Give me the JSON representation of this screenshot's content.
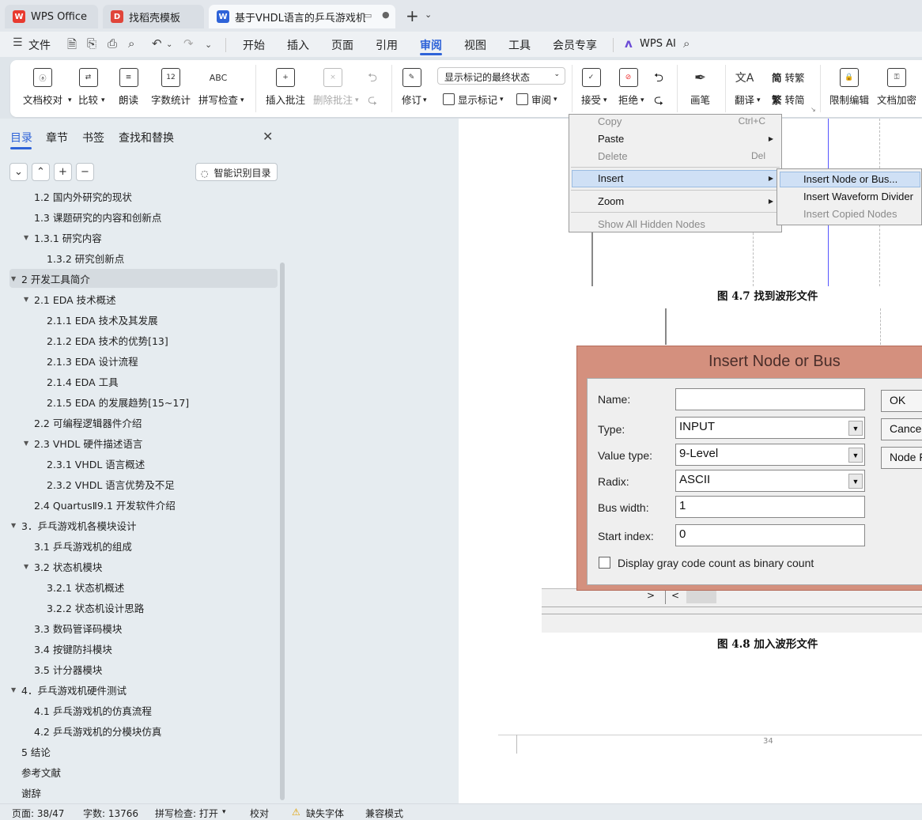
{
  "tabs": [
    {
      "label": "WPS Office",
      "icon": "wps-logo-icon"
    },
    {
      "label": "找稻壳模板",
      "icon": "docer-icon"
    },
    {
      "label": "基于VHDL语言的乒乓游戏机电",
      "icon": "word-doc-icon"
    }
  ],
  "menu": {
    "file": "文件",
    "items": [
      "开始",
      "插入",
      "页面",
      "引用",
      "审阅",
      "视图",
      "工具",
      "会员专享"
    ],
    "active": "审阅",
    "wps_ai": "WPS AI"
  },
  "ribbon": {
    "doc_check": "文档校对",
    "compare": "比较",
    "read_aloud": "朗读",
    "word_count": "字数统计",
    "spell_check": "拼写检查",
    "insert_comment": "插入批注",
    "delete_comment": "删除批注",
    "revise": "修订",
    "markup_select": "显示标记的最终状态",
    "show_markup": "显示标记",
    "review": "审阅",
    "accept": "接受",
    "reject": "拒绝",
    "pen": "画笔",
    "translate": "翻译",
    "to_traditional": "转繁",
    "to_simplified": "转简",
    "restrict_edit": "限制编辑",
    "encrypt": "文档加密"
  },
  "nav": {
    "tabs": [
      "目录",
      "章节",
      "书签",
      "查找和替换"
    ],
    "active_tab": "目录",
    "smart_toc": "智能识别目录"
  },
  "toc": [
    {
      "text": "1.2 国内外研究的现状",
      "level": 2,
      "expand": ""
    },
    {
      "text": "1.3 课题研究的内容和创新点",
      "level": 2,
      "expand": ""
    },
    {
      "text": "1.3.1  研究内容",
      "level": 2,
      "expand": "▼"
    },
    {
      "text": "1.3.2  研究创新点",
      "level": 3,
      "expand": ""
    },
    {
      "text": "2  开发工具简介",
      "level": 1,
      "expand": "▼",
      "selected": true
    },
    {
      "text": "2.1 EDA 技术概述",
      "level": 2,
      "expand": "▼"
    },
    {
      "text": "2.1.1 EDA 技术及其发展",
      "level": 3,
      "expand": ""
    },
    {
      "text": "2.1.2 EDA 技术的优势[13]",
      "level": 3,
      "expand": ""
    },
    {
      "text": "2.1.3 EDA 设计流程",
      "level": 3,
      "expand": ""
    },
    {
      "text": "2.1.4 EDA 工具",
      "level": 3,
      "expand": ""
    },
    {
      "text": "2.1.5 EDA 的发展趋势[15~17]",
      "level": 3,
      "expand": ""
    },
    {
      "text": "2.2 可编程逻辑器件介绍",
      "level": 2,
      "expand": ""
    },
    {
      "text": "2.3 VHDL 硬件描述语言",
      "level": 2,
      "expand": "▼"
    },
    {
      "text": "2.3.1 VHDL 语言概述",
      "level": 3,
      "expand": ""
    },
    {
      "text": "2.3.2 VHDL 语言优势及不足",
      "level": 3,
      "expand": ""
    },
    {
      "text": "2.4 QuartusⅡ9.1 开发软件介绍",
      "level": 2,
      "expand": ""
    },
    {
      "text": "3．乒乓游戏机各模块设计",
      "level": 1,
      "expand": "▼"
    },
    {
      "text": "3.1 乒乓游戏机的组成",
      "level": 2,
      "expand": ""
    },
    {
      "text": "3.2 状态机模块",
      "level": 2,
      "expand": "▼"
    },
    {
      "text": "3.2.1  状态机概述",
      "level": 3,
      "expand": ""
    },
    {
      "text": "3.2.2  状态机设计思路",
      "level": 3,
      "expand": ""
    },
    {
      "text": "3.3 数码管译码模块",
      "level": 2,
      "expand": ""
    },
    {
      "text": "3.4 按键防抖模块",
      "level": 2,
      "expand": ""
    },
    {
      "text": "3.5 计分器模块",
      "level": 2,
      "expand": ""
    },
    {
      "text": "4．乒乓游戏机硬件测试",
      "level": 1,
      "expand": "▼"
    },
    {
      "text": "4.1 乒乓游戏机的仿真流程",
      "level": 2,
      "expand": ""
    },
    {
      "text": "4.2 乒乓游戏机的分模块仿真",
      "level": 2,
      "expand": ""
    },
    {
      "text": "5  结论",
      "level": 1,
      "expand": ""
    },
    {
      "text": "参考文献",
      "level": 1,
      "expand": ""
    },
    {
      "text": "谢辞",
      "level": 1,
      "expand": ""
    }
  ],
  "document": {
    "fig1": {
      "context_menu": [
        {
          "label": "Copy",
          "shortcut": "Ctrl+C"
        },
        {
          "label": "Paste",
          "shortcut": ""
        },
        {
          "label": "Delete",
          "shortcut": "Del"
        },
        {
          "label": "Insert",
          "shortcut": ""
        },
        {
          "label": "Zoom",
          "shortcut": ""
        },
        {
          "label": "Show All Hidden Nodes",
          "shortcut": ""
        }
      ],
      "submenu": [
        "Insert Node or Bus...",
        "Insert Waveform Divider",
        "Insert Copied Nodes"
      ],
      "caption": "图 4.7  找到波形文件"
    },
    "fig2": {
      "title": "Insert Node or Bus",
      "labels": [
        "Name:",
        "Type:",
        "Value type:",
        "Radix:",
        "Bus width:",
        "Start index:"
      ],
      "values": [
        "",
        "INPUT",
        "9-Level",
        "ASCII",
        "1",
        "0"
      ],
      "buttons": [
        "OK",
        "Cancel",
        "Node Finder..."
      ],
      "checkbox": "Display gray code count as binary count",
      "caption": "图 4.8  加入波形文件"
    },
    "page_number": "34"
  },
  "status": {
    "page": "页面: 38/47",
    "words": "字数: 13766",
    "spell": "拼写检查: 打开",
    "proof": "校对",
    "missing_font": "缺失字体",
    "compat": "兼容模式"
  },
  "colors": {
    "accent": "#2e63d8",
    "wps_red": "#e83a2f",
    "dialog_frame": "#d4907e",
    "menu_highlight": "#cfe0f5"
  }
}
